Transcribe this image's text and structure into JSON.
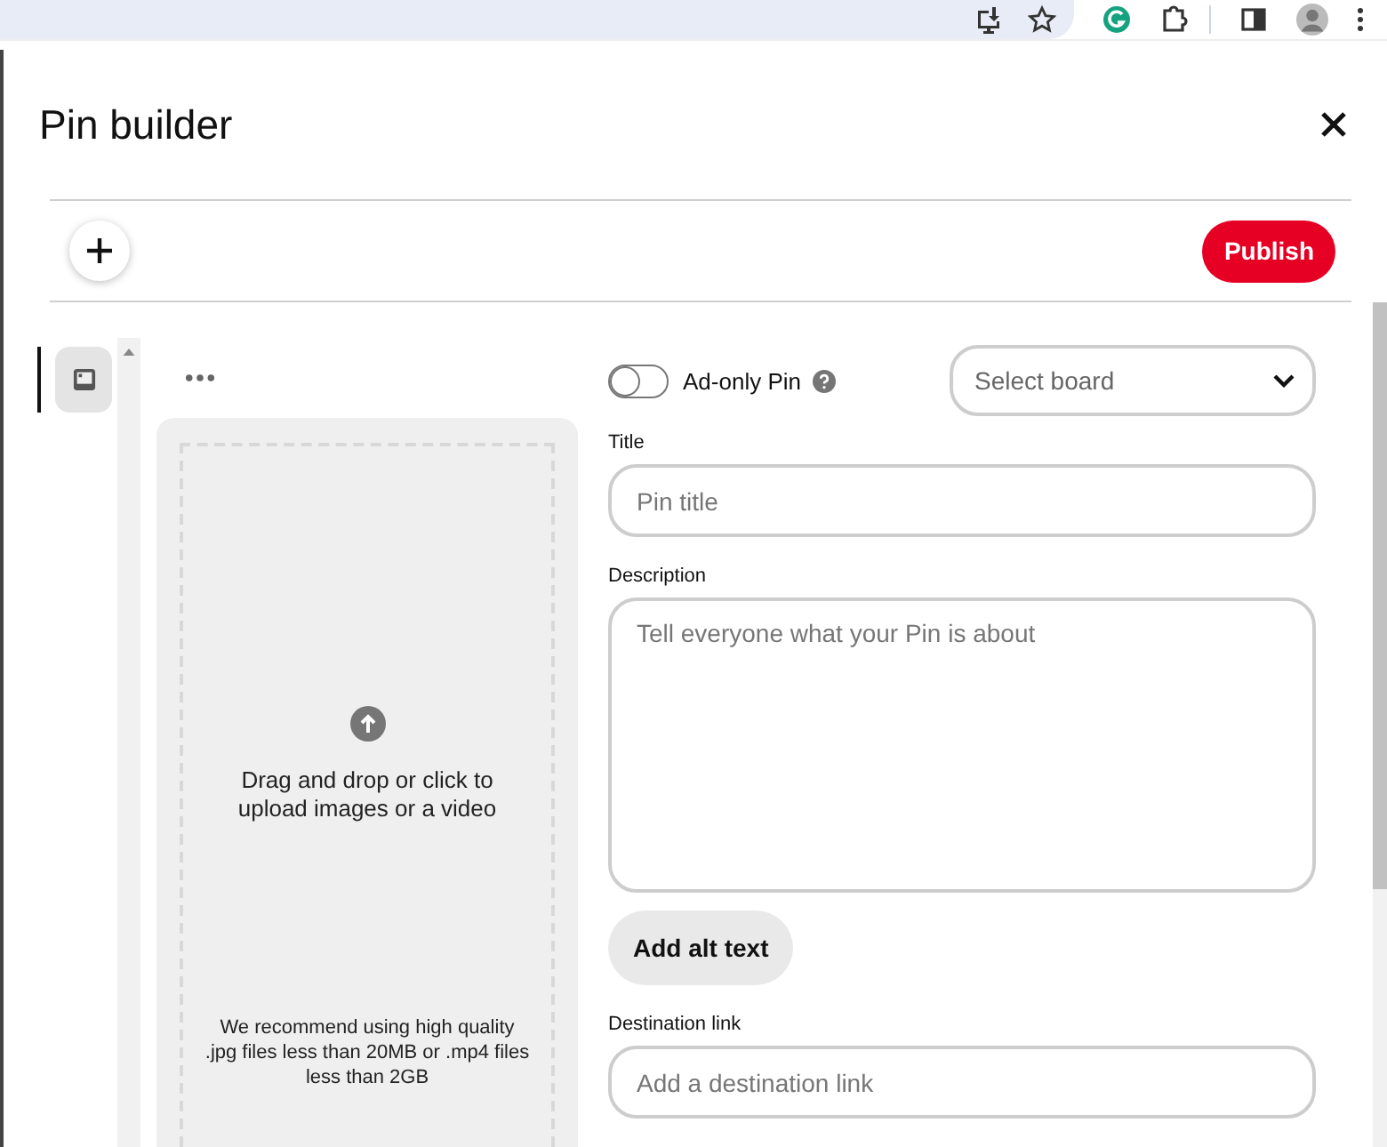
{
  "modal": {
    "title": "Pin builder"
  },
  "toolbar": {
    "publish": "Publish"
  },
  "side_tabs": [
    {
      "kind": "image",
      "selected": true
    }
  ],
  "upload": {
    "prompt": "Drag and drop or click to upload images or a video",
    "note": "We recommend using high quality .jpg files less than 20MB or .mp4 files less than 2GB"
  },
  "form": {
    "ad_only": {
      "label": "Ad-only Pin",
      "on": false
    },
    "board": {
      "placeholder": "Select board"
    },
    "fields": [
      {
        "kind": "line",
        "label": "Title",
        "placeholder": "Pin title"
      },
      {
        "kind": "area",
        "label": "Description",
        "placeholder": "Tell everyone what your Pin is about"
      },
      {
        "kind": "button",
        "label": "Add alt text"
      },
      {
        "kind": "line",
        "label": "Destination link",
        "placeholder": "Add a destination link"
      }
    ]
  }
}
